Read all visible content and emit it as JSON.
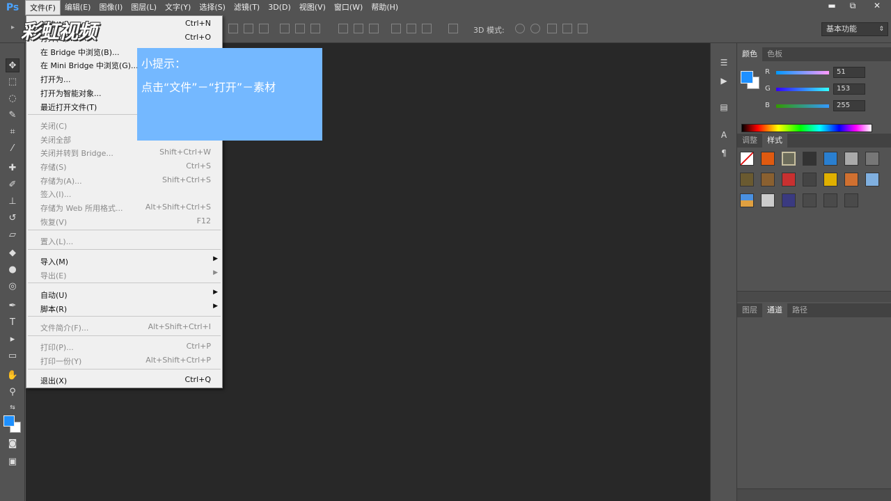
{
  "app": {
    "logo": "Ps"
  },
  "menubar": {
    "items": [
      "文件(F)",
      "编辑(E)",
      "图像(I)",
      "图层(L)",
      "文字(Y)",
      "选择(S)",
      "滤镜(T)",
      "3D(D)",
      "视图(V)",
      "窗口(W)",
      "帮助(H)"
    ]
  },
  "window_controls": {
    "minimize": "▬",
    "restore": "⧉",
    "close": "✕"
  },
  "options_bar": {
    "mode_3d_label": "3D 模式:",
    "workspace": "基本功能"
  },
  "color_panel": {
    "tabs": [
      "颜色",
      "色板"
    ],
    "r": {
      "label": "R",
      "value": "51"
    },
    "g": {
      "label": "G",
      "value": "153"
    },
    "b": {
      "label": "B",
      "value": "255"
    },
    "foreground": "#3399ff"
  },
  "styles_panel": {
    "tabs": [
      "调整",
      "样式"
    ]
  },
  "layers_panel": {
    "tabs": [
      "图层",
      "通道",
      "路径"
    ]
  },
  "file_menu": {
    "items": [
      {
        "label": "新建(N)...",
        "shortcut": "Ctrl+N",
        "disabled": false
      },
      {
        "label": "打开(O)...",
        "shortcut": "Ctrl+O",
        "disabled": false
      },
      {
        "label": "在 Bridge 中浏览(B)...",
        "shortcut": "",
        "disabled": false
      },
      {
        "label": "在 Mini Bridge 中浏览(G)...",
        "shortcut": "",
        "disabled": false
      },
      {
        "label": "打开为...",
        "shortcut": "",
        "disabled": false
      },
      {
        "label": "打开为智能对象...",
        "shortcut": "",
        "disabled": false
      },
      {
        "label": "最近打开文件(T)",
        "shortcut": "",
        "disabled": false
      },
      {
        "label": "关闭(C)",
        "shortcut": "",
        "disabled": true
      },
      {
        "label": "关闭全部",
        "shortcut": "",
        "disabled": true
      },
      {
        "label": "关闭并转到 Bridge...",
        "shortcut": "Shift+Ctrl+W",
        "disabled": true
      },
      {
        "label": "存储(S)",
        "shortcut": "Ctrl+S",
        "disabled": true
      },
      {
        "label": "存储为(A)...",
        "shortcut": "Shift+Ctrl+S",
        "disabled": true
      },
      {
        "label": "签入(I)...",
        "shortcut": "",
        "disabled": true
      },
      {
        "label": "存储为 Web 所用格式...",
        "shortcut": "Alt+Shift+Ctrl+S",
        "disabled": true
      },
      {
        "label": "恢复(V)",
        "shortcut": "F12",
        "disabled": true
      },
      {
        "label": "置入(L)...",
        "shortcut": "",
        "disabled": true
      },
      {
        "label": "导入(M)",
        "shortcut": "",
        "disabled": false
      },
      {
        "label": "导出(E)",
        "shortcut": "",
        "disabled": true
      },
      {
        "label": "自动(U)",
        "shortcut": "",
        "disabled": false
      },
      {
        "label": "脚本(R)",
        "shortcut": "",
        "disabled": false
      },
      {
        "label": "文件简介(F)...",
        "shortcut": "Alt+Shift+Ctrl+I",
        "disabled": true
      },
      {
        "label": "打印(P)...",
        "shortcut": "Ctrl+P",
        "disabled": true
      },
      {
        "label": "打印一份(Y)",
        "shortcut": "Alt+Shift+Ctrl+P",
        "disabled": true
      },
      {
        "label": "退出(X)",
        "shortcut": "Ctrl+Q",
        "disabled": false
      }
    ]
  },
  "watermark": "彩虹视频",
  "tip": {
    "title": "小提示：",
    "body": "点击“文件”－“打开”－素材"
  }
}
